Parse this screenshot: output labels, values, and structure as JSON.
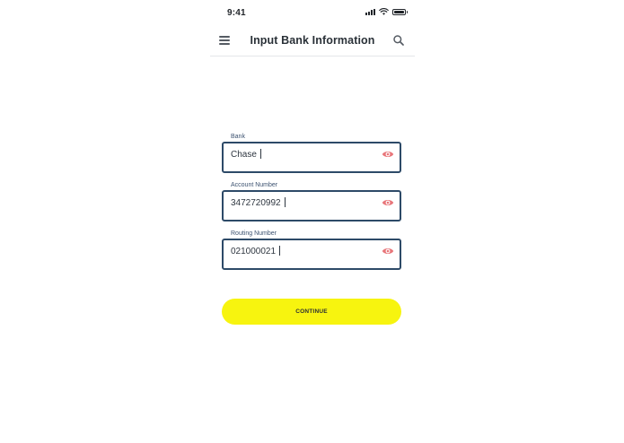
{
  "status_bar": {
    "time": "9:41"
  },
  "header": {
    "title": "Input Bank Information",
    "left_icon": "menu-icon",
    "right_icon": "search-icon"
  },
  "form": {
    "fields": [
      {
        "label": "Bank",
        "value": "Chase",
        "icon": "eye-icon"
      },
      {
        "label": "Account Number",
        "value": "3472720992",
        "icon": "eye-icon"
      },
      {
        "label": "Routing Number",
        "value": "021000021",
        "icon": "eye-icon"
      }
    ],
    "submit_label": "CONTINUE"
  },
  "colors": {
    "accent": "#f7f40f",
    "field_border": "#2d4a68",
    "eye_icon": "#e8767a",
    "label": "#3c5270"
  }
}
